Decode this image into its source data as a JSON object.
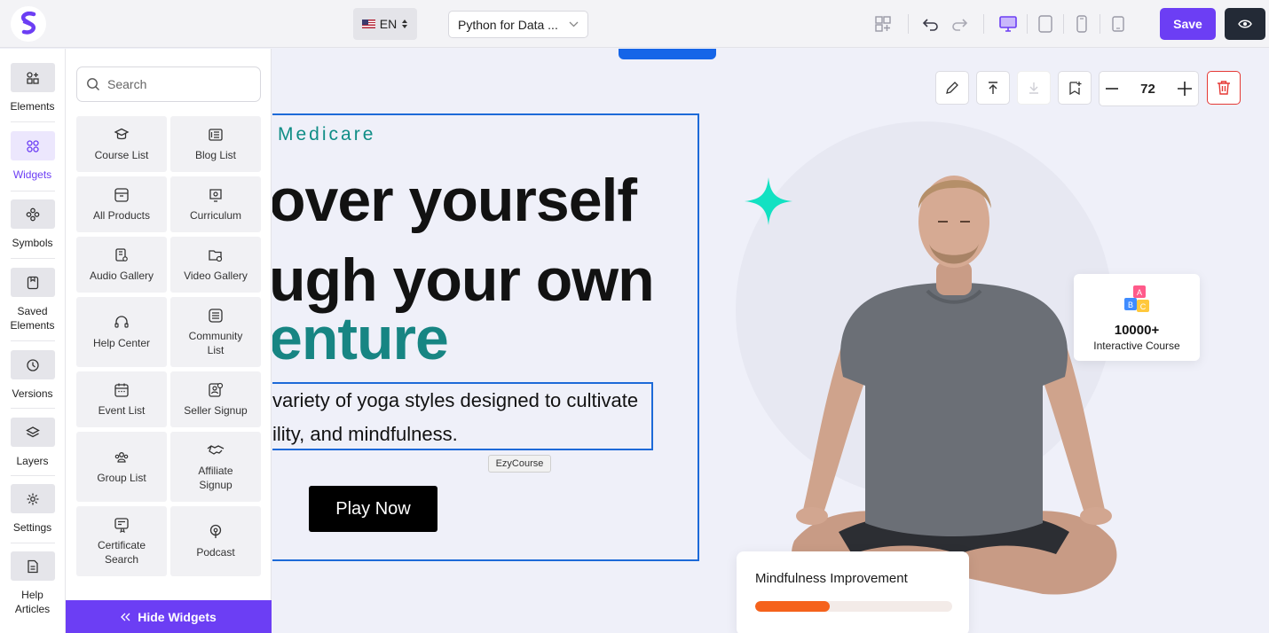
{
  "topbar": {
    "language": "EN",
    "course_select": "Python for Data ...",
    "save_label": "Save"
  },
  "rail": {
    "items": [
      {
        "label": "Elements",
        "icon": "elements-icon"
      },
      {
        "label": "Widgets",
        "icon": "widgets-icon"
      },
      {
        "label": "Symbols",
        "icon": "symbols-icon"
      },
      {
        "label": "Saved Elements",
        "icon": "saved-elements-icon"
      },
      {
        "label": "Versions",
        "icon": "versions-icon"
      },
      {
        "label": "Layers",
        "icon": "layers-icon"
      },
      {
        "label": "Settings",
        "icon": "settings-icon"
      },
      {
        "label": "Help Articles",
        "icon": "help-articles-icon"
      }
    ]
  },
  "widgets": {
    "search_placeholder": "Search",
    "items": [
      {
        "label": "Course List",
        "icon": "course-list-icon"
      },
      {
        "label": "Blog List",
        "icon": "blog-list-icon"
      },
      {
        "label": "All Products",
        "icon": "all-products-icon"
      },
      {
        "label": "Curriculum",
        "icon": "curriculum-icon"
      },
      {
        "label": "Audio Gallery",
        "icon": "audio-gallery-icon"
      },
      {
        "label": "Video Gallery",
        "icon": "video-gallery-icon"
      },
      {
        "label": "Help Center",
        "icon": "help-center-icon"
      },
      {
        "label": "Community List",
        "icon": "community-list-icon"
      },
      {
        "label": "Event List",
        "icon": "event-list-icon"
      },
      {
        "label": "Seller Signup",
        "icon": "seller-signup-icon"
      },
      {
        "label": "Group List",
        "icon": "group-list-icon"
      },
      {
        "label": "Affiliate Signup",
        "icon": "affiliate-signup-icon"
      },
      {
        "label": "Certificate Search",
        "icon": "certificate-search-icon"
      },
      {
        "label": "Podcast",
        "icon": "podcast-icon"
      }
    ],
    "hide_label": "Hide Widgets"
  },
  "canvas": {
    "brand": "Medicare",
    "heading_line1": "over yourself",
    "heading_line2": "ugh your own",
    "heading_line3": "enture",
    "para_line1": "variety of yoga styles designed to cultivate",
    "para_line2": "ility, and mindfulness.",
    "tooltip": "EzyCourse",
    "play_label": "Play Now",
    "zoom_value": "72",
    "stat_number": "10000+",
    "stat_label": "Interactive Course",
    "mind_title": "Mindfulness Improvement",
    "mind_progress": 0.38
  },
  "colors": {
    "accent": "#6c3ef4",
    "teal": "#178583",
    "selection": "#1d6ad8",
    "progress": "#f5621c"
  }
}
